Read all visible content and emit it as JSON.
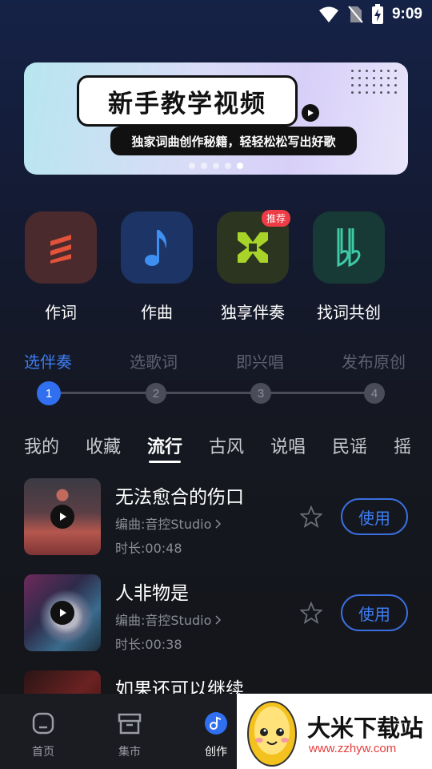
{
  "status_bar": {
    "time": "9:09"
  },
  "banner": {
    "title": "新手教学视频",
    "subtitle": "独家词曲创作秘籍，轻轻松松写出好歌",
    "page_count": 5,
    "active_page": 5
  },
  "features": [
    {
      "label": "作词",
      "icon": "lyrics-icon",
      "color": "#e2533a"
    },
    {
      "label": "作曲",
      "icon": "music-note-icon",
      "color": "#3d8ff2"
    },
    {
      "label": "独享伴奏",
      "icon": "accompaniment-icon",
      "color": "#a8d42a",
      "badge": "推荐"
    },
    {
      "label": "找词共创",
      "icon": "double-flat-icon",
      "color": "#3ec9a7"
    }
  ],
  "steps": [
    {
      "label": "选伴奏",
      "number": "1",
      "active": true
    },
    {
      "label": "选歌词",
      "number": "2",
      "active": false
    },
    {
      "label": "即兴唱",
      "number": "3",
      "active": false
    },
    {
      "label": "发布原创",
      "number": "4",
      "active": false
    }
  ],
  "tabs": [
    {
      "label": "我的",
      "active": false
    },
    {
      "label": "收藏",
      "active": false
    },
    {
      "label": "流行",
      "active": true
    },
    {
      "label": "古风",
      "active": false
    },
    {
      "label": "说唱",
      "active": false
    },
    {
      "label": "民谣",
      "active": false
    },
    {
      "label": "摇",
      "active": false
    }
  ],
  "songs": [
    {
      "title": "无法愈合的伤口",
      "composer": "编曲:音控Studio",
      "duration": "时长:00:48",
      "action": "使用"
    },
    {
      "title": "人非物是",
      "composer": "编曲:音控Studio",
      "duration": "时长:00:38",
      "action": "使用"
    },
    {
      "title": "如果还可以继续",
      "composer": "",
      "duration": "",
      "action": ""
    }
  ],
  "bottom_nav": [
    {
      "label": "首页",
      "icon": "home-icon",
      "active": false
    },
    {
      "label": "集市",
      "icon": "market-icon",
      "active": false
    },
    {
      "label": "创作",
      "icon": "create-icon",
      "active": true
    }
  ],
  "watermark": {
    "title": "大米下载站",
    "url": "www.zzhyw.com"
  },
  "colors": {
    "accent": "#3d7cf2",
    "badge": "#ee3b45"
  }
}
